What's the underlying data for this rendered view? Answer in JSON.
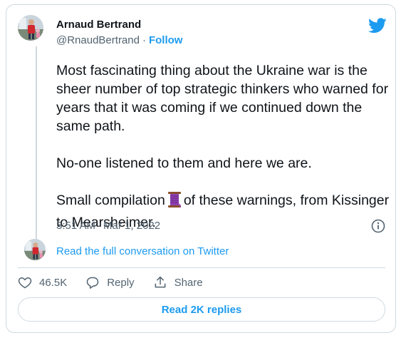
{
  "author": {
    "name": "Arnaud Bertrand",
    "handle": "@RnaudBertrand",
    "separator": "·",
    "follow_label": "Follow"
  },
  "tweet": {
    "paragraphs": [
      "Most fascinating thing about the Ukraine war is the sheer number of top strategic thinkers who warned for years that it was coming if we continued down the same path.",
      "No-one listened to them and here we are."
    ],
    "last_before": "Small compilation",
    "last_after": "of these warnings, from Kissinger to Mearsheimer.",
    "time": "3:51 AM",
    "date": "Mar 1, 2022"
  },
  "conversation_link": "Read the full conversation on Twitter",
  "actions": {
    "likes": "46.5K",
    "reply_label": "Reply",
    "share_label": "Share"
  },
  "read_replies_label": "Read 2K replies",
  "icons": {
    "brand": "twitter-bird-icon",
    "emoji": "thread-spool-icon",
    "info": "info-icon",
    "like": "heart-icon",
    "reply": "speech-bubble-icon",
    "share": "upload-share-icon"
  },
  "colors": {
    "accent": "#1d9bf0",
    "text": "#0f1419",
    "secondary": "#536471",
    "border": "#cfd9de"
  }
}
